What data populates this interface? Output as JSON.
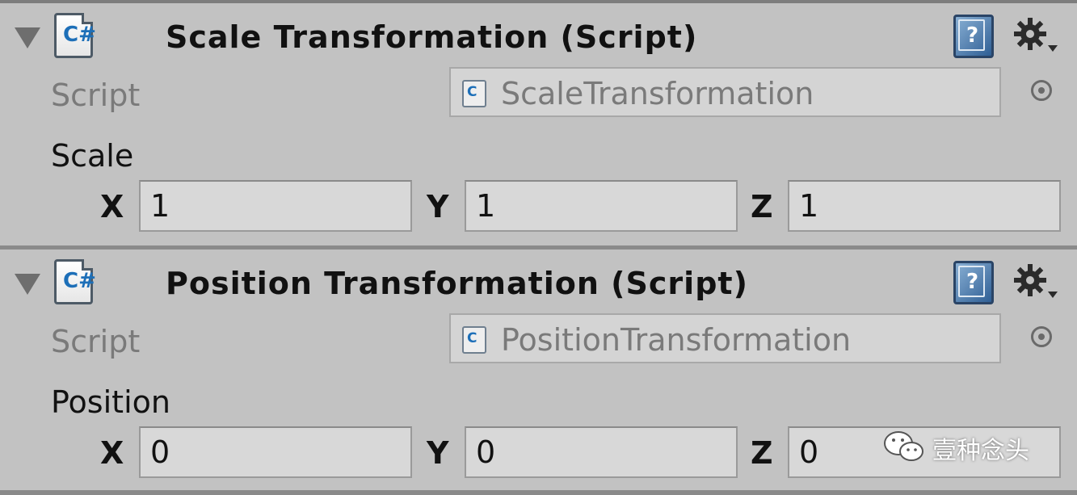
{
  "components": [
    {
      "title": "Scale Transformation (Script)",
      "script_label": "Script",
      "script_value": "ScaleTransformation",
      "vector_label": "Scale",
      "axes": [
        {
          "axis": "X",
          "value": "1"
        },
        {
          "axis": "Y",
          "value": "1"
        },
        {
          "axis": "Z",
          "value": "1"
        }
      ]
    },
    {
      "title": "Position Transformation (Script)",
      "script_label": "Script",
      "script_value": "PositionTransformation",
      "vector_label": "Position",
      "axes": [
        {
          "axis": "X",
          "value": "0"
        },
        {
          "axis": "Y",
          "value": "0"
        },
        {
          "axis": "Z",
          "value": "0"
        }
      ]
    }
  ],
  "icons": {
    "script_glyph": "C#",
    "script_glyph_small": "C",
    "help_glyph": "?"
  },
  "watermark": {
    "text": "壹种念头"
  },
  "colors": {
    "background": "#c2c2c2",
    "field_background": "#d8d8d8",
    "disabled_text": "#7a7a7a",
    "text": "#111111",
    "help_blue": "#2f5f95",
    "script_blue": "#1d6fb8"
  }
}
